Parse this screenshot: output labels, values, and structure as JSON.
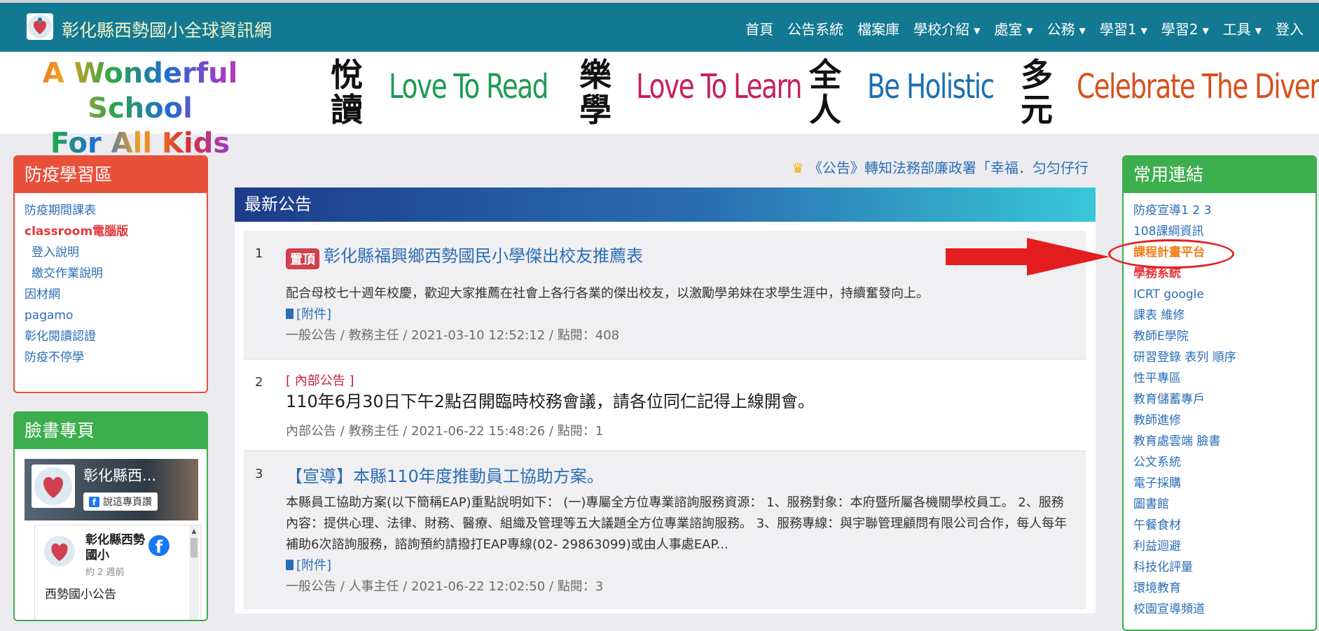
{
  "navbar": {
    "site_title": "彰化縣西勢國小全球資訊網",
    "items": [
      {
        "label": "首頁",
        "dropdown": false,
        "active": true
      },
      {
        "label": "公告系統",
        "dropdown": false
      },
      {
        "label": "檔案庫",
        "dropdown": false
      },
      {
        "label": "學校介紹",
        "dropdown": true
      },
      {
        "label": "處室",
        "dropdown": true
      },
      {
        "label": "公務",
        "dropdown": true
      },
      {
        "label": "學習1",
        "dropdown": true
      },
      {
        "label": "學習2",
        "dropdown": true
      },
      {
        "label": "工具",
        "dropdown": true
      },
      {
        "label": "登入",
        "dropdown": false
      }
    ]
  },
  "banner": {
    "wonder_line1": "A Wonderful School",
    "wonder_line2": "For All Kids",
    "groups": [
      {
        "chars": "悅讀",
        "slogan": "Love To Read",
        "color": "#1e9b54"
      },
      {
        "chars": "樂學",
        "slogan": "Love To Learn",
        "color": "#c8215a"
      },
      {
        "chars": "全人",
        "slogan": "Be Holistic",
        "color": "#1c6fb0"
      },
      {
        "chars": "多元",
        "slogan": "Celebrate The Diversity",
        "color": "#d8501e"
      }
    ]
  },
  "left_panel_1": {
    "title": "防疫學習區",
    "items": [
      "防疫期間課表",
      "classroom電腦版",
      "登入說明",
      "繳交作業說明",
      "因材網",
      "pagamo",
      "彰化閱讀認證",
      "防疫不停學"
    ]
  },
  "left_panel_2": {
    "title": "臉書專頁",
    "fb_cover_name": "彰化縣西...",
    "fb_like_label": "說這專頁讚",
    "fb_page_name": "彰化縣西勢國小",
    "fb_time": "約 2 週前",
    "fb_post_text": "西勢國小公告"
  },
  "marquee": "《公告》轉知法務部廉政署「幸福．匀匀仔行",
  "main": {
    "header": "最新公告",
    "news": [
      {
        "num": "1",
        "badge": "置頂",
        "title": "彰化縣福興鄉西勢國民小學傑出校友推薦表",
        "desc": "配合母校七十週年校慶，歡迎大家推薦在社會上各行各業的傑出校友，以激勵學弟妹在求學生涯中，持續奮發向上。",
        "attach": "[附件]",
        "meta": "一般公告 / 教務主任 / 2021-03-10 12:52:12 / 點閱：408"
      },
      {
        "num": "2",
        "tag": "[ 內部公告 ]",
        "title": "110年6月30日下午2點召開臨時校務會議，請各位同仁記得上線開會。",
        "meta": "內部公告 / 教務主任 / 2021-06-22 15:48:26 / 點閱：1"
      },
      {
        "num": "3",
        "title": "【宣導】本縣110年度推動員工協助方案。",
        "desc": "本縣員工協助方案(以下簡稱EAP)重點說明如下： (一)專屬全方位專業諮詢服務資源： 1、服務對象：本府暨所屬各機關學校員工。 2、服務內容：提供心理、法律、財務、醫療、組織及管理等五大議題全方位專業諮詢服務。 3、服務專線：與宇聯管理顧問有限公司合作，每人每年補助6次諮詢服務，諮詢預約請撥打EAP專線(02- 29863099)或由人事處EAP...",
        "attach": "[附件]",
        "meta": "一般公告 / 人事主任 / 2021-06-22 12:02:50 / 點閱：3"
      }
    ]
  },
  "right_panel": {
    "title": "常用連結",
    "items": [
      "防疫宣導1 2 3",
      "108課綱資訊",
      "課程計畫平台",
      "學務系統",
      "ICRT google",
      "課表 維修",
      "教師E學院",
      "研習登錄 表列 順序",
      "性平專區",
      "教育儲蓄專戶",
      "教師進修",
      "教育處雲端 臉書",
      "公文系統",
      "電子採購",
      "圖書館",
      "午餐食材",
      "利益迴避",
      "科技化評量",
      "環境教育",
      "校園宣導頻道"
    ]
  },
  "colors": {
    "navbar": "#137992",
    "left_panel_1_head": "#e8503a",
    "panel_green_head": "#3cae4e",
    "link": "#2a6db5",
    "highlight_orange": "#f07f16",
    "highlight_red": "#e5363b",
    "annotation_red": "#e41e1e"
  }
}
